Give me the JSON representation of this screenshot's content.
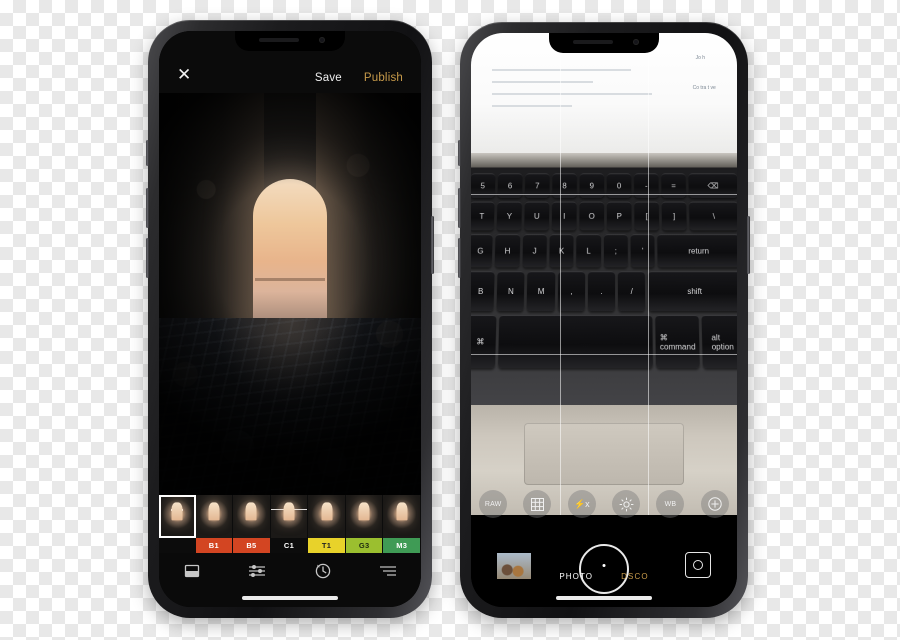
{
  "scene": {
    "description": "Two iPhone X mockups side by side on transparent checkerboard background",
    "background": "transparent-checkerboard"
  },
  "left_phone": {
    "name": "photo-editor-screen",
    "topbar": {
      "close_icon": "close-x-icon",
      "save_label": "Save",
      "publish_label": "Publish",
      "publish_color": "#c89b4a"
    },
    "photo": {
      "alt": "dark stone tunnel opening to bright sunlit beach"
    },
    "filters": [
      {
        "label": "",
        "marker": "dash",
        "color": "#0c0c0c",
        "selected": true
      },
      {
        "label": "B1",
        "marker": "none",
        "color": "#d34522",
        "selected": false
      },
      {
        "label": "B5",
        "marker": "none",
        "color": "#d34522",
        "selected": false
      },
      {
        "label": "C1",
        "marker": "slider",
        "color": "#0c0c0c",
        "selected": false
      },
      {
        "label": "T1",
        "marker": "none",
        "color": "#e8d22a",
        "selected": false
      },
      {
        "label": "G3",
        "marker": "none",
        "color": "#9bbf2f",
        "selected": false
      },
      {
        "label": "M3",
        "marker": "none",
        "color": "#3f9b55",
        "selected": false
      }
    ],
    "tools": [
      {
        "icon": "crop-frame-icon",
        "label": ""
      },
      {
        "icon": "sliders-icon",
        "label": ""
      },
      {
        "icon": "undo-history-icon",
        "label": ""
      },
      {
        "icon": "adjust-lines-icon",
        "label": ""
      }
    ]
  },
  "right_phone": {
    "name": "camera-capture-screen",
    "viewfinder": {
      "alt": "close-up of laptop keyboard with command and option keys visible",
      "grid": "3x3-thirds-grid",
      "keys_visible": [
        "T",
        "Y",
        "U",
        "I",
        "O",
        "P",
        "G",
        "H",
        "J",
        "K",
        "L",
        "B",
        "N",
        "M",
        "command",
        "option",
        "alt"
      ]
    },
    "controls": [
      {
        "icon": "raw-badge-icon",
        "label": "RAW"
      },
      {
        "icon": "grid-icon",
        "label": ""
      },
      {
        "icon": "flash-off-icon",
        "label": "⚡x"
      },
      {
        "icon": "brightness-icon",
        "label": ""
      },
      {
        "icon": "white-balance-icon",
        "label": "WB"
      },
      {
        "icon": "plus-circle-icon",
        "label": "+"
      }
    ],
    "bottom": {
      "gallery_icon": "gallery-thumbnail",
      "shutter_icon": "shutter-button",
      "flip_icon": "flip-camera-icon",
      "modes": [
        {
          "label": "PHOTO",
          "active": true
        },
        {
          "label": "DSCO",
          "active": false,
          "color": "#c89b4a"
        }
      ]
    }
  }
}
